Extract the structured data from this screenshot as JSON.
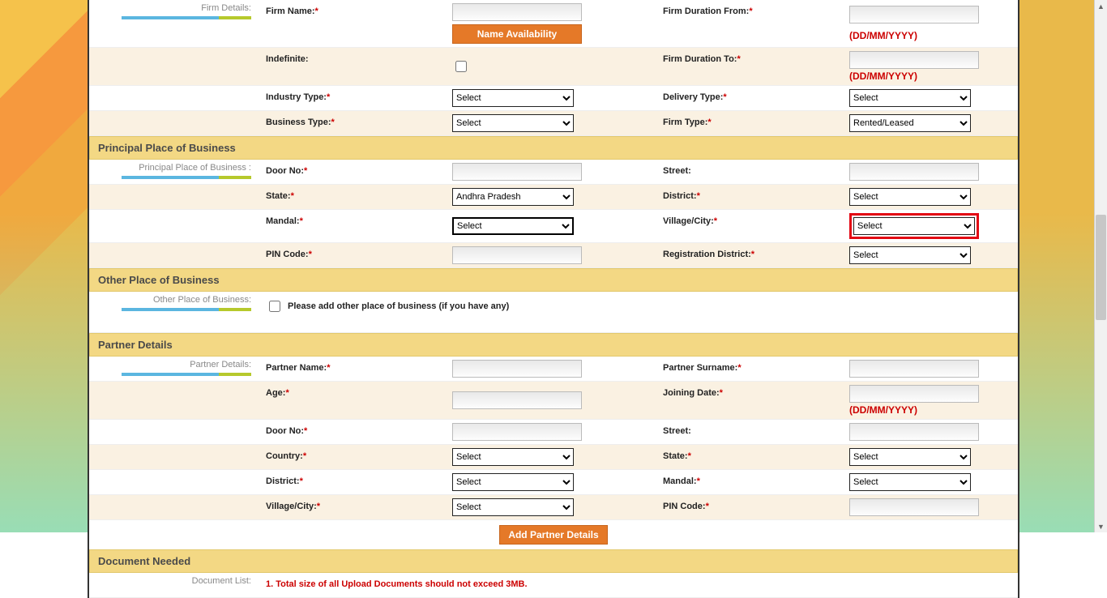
{
  "firm": {
    "sideLabel": "Firm Details:",
    "firmName": "Firm Name:",
    "nameAvailBtn": "Name Availability",
    "firmDurationFrom": "Firm Duration From:",
    "dateHint": "(DD/MM/YYYY)",
    "indefinite": "Indefinite:",
    "firmDurationTo": "Firm Duration To:",
    "industryType": "Industry Type:",
    "deliveryType": "Delivery Type:",
    "businessType": "Business Type:",
    "firmType": "Firm Type:",
    "optSelect": "Select",
    "optRented": "Rented/Leased"
  },
  "principal": {
    "header": "Principal Place of Business",
    "sideLabel": "Principal Place of Business :",
    "doorNo": "Door No:",
    "street": "Street:",
    "state": "State:",
    "district": "District:",
    "mandal": "Mandal:",
    "villageCity": "Village/City:",
    "pinCode": "PIN Code:",
    "regDistrict": "Registration District:",
    "optAP": "Andhra Pradesh",
    "optSelect": "Select"
  },
  "other": {
    "header": "Other Place of Business",
    "sideLabel": "Other Place of Business:",
    "checkboxLabel": "Please add other place of business (if you have any)"
  },
  "partner": {
    "header": "Partner Details",
    "sideLabel": "Partner Details:",
    "partnerName": "Partner Name:",
    "partnerSurname": "Partner Surname:",
    "age": "Age:",
    "joiningDate": "Joining Date:",
    "doorNo": "Door No:",
    "street": "Street:",
    "country": "Country:",
    "state": "State:",
    "district": "District:",
    "mandal": "Mandal:",
    "villageCity": "Village/City:",
    "pinCode": "PIN Code:",
    "optSelect": "Select",
    "addBtn": "Add Partner Details",
    "dateHint": "(DD/MM/YYYY)"
  },
  "document": {
    "header": "Document Needed",
    "sideLabel": "Document List:",
    "warn": "1. Total size of all Upload Documents should not exceed 3MB."
  }
}
